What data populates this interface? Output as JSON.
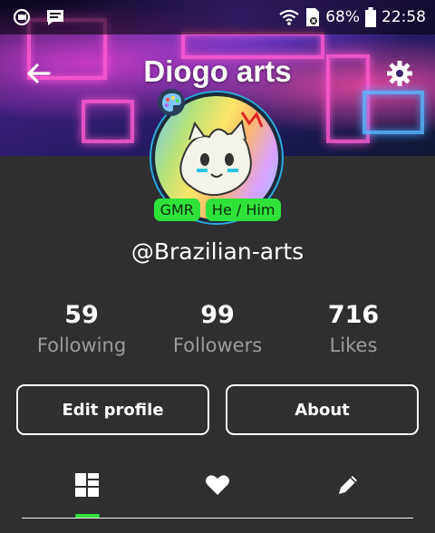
{
  "status_bar": {
    "battery": "68%",
    "time": "22:58",
    "icons": [
      "screen-record-icon",
      "message-icon",
      "wifi-icon",
      "sim-card-icon",
      "battery-icon"
    ]
  },
  "header": {
    "title": "Diogo arts"
  },
  "profile": {
    "tags": [
      "GMR",
      "He / Him"
    ],
    "username": "@Brazilian-arts"
  },
  "stats": [
    {
      "value": "59",
      "label": "Following"
    },
    {
      "value": "99",
      "label": "Followers"
    },
    {
      "value": "716",
      "label": "Likes"
    }
  ],
  "buttons": {
    "edit": "Edit profile",
    "about": "About"
  },
  "tabs": [
    "grid-icon",
    "heart-icon",
    "pencil-icon"
  ],
  "colors": {
    "accent": "#2ee23a",
    "background": "#2f2f31",
    "muted_text": "#9c9c9c"
  }
}
